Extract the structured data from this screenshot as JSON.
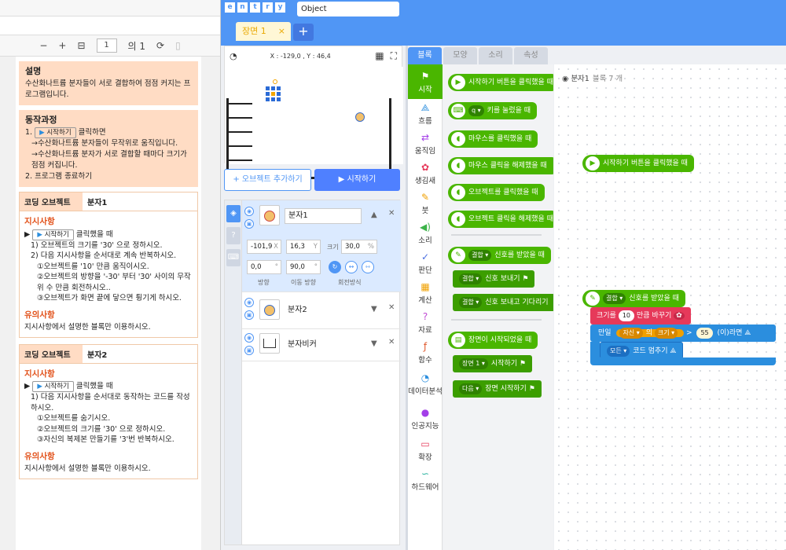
{
  "pdf": {
    "toolbar": {
      "minus": "−",
      "plus": "+",
      "page": "1",
      "of": "의 1"
    },
    "desc": {
      "title": "설명",
      "text": "수산화나트륨 분자들이 서로 결합하여 점점 커지는 프로그램입니다."
    },
    "process": {
      "title": "동작과정",
      "step1_pre": "1.",
      "start_btn": "시작하기",
      "step1_post": "클릭하면",
      "sub1": "→수산화나트륨 분자들이 무작위로 움직입니다.",
      "sub2": "→수산화나트륨 분자가 서로 결합할 때마다 크기가 점점 커집니다.",
      "step2": "2. 프로그램 종료하기"
    },
    "obj1": {
      "label": "코딩 오브젝트",
      "name": "분자1",
      "instr_title": "지시사항",
      "start_btn": "시작하기",
      "click_text": "클릭했을 때",
      "l1": "1) 오브젝트의 크기를 '30' 으로 정하시오.",
      "l2": "2) 다음 지시사항을 순서대로 계속 반복하시오.",
      "l3": "①오브젝트를 '10' 만큼 움직이시오.",
      "l4": "②오브젝트의 방향을 '-30' 부터 '30' 사이의 무작위 수 만큼 회전하시오..",
      "l5": "③오브젝트가 화면 끝에 닿으면 튕기게 하시오.",
      "note_title": "유의사항",
      "note": "지시사항에서 설명한 블록만 이용하시오."
    },
    "obj2": {
      "label": "코딩 오브젝트",
      "name": "분자2",
      "instr_title": "지시사항",
      "start_btn": "시작하기",
      "click_text": "클릭했을 때",
      "l1": "1) 다음 지시사항을 순서대로 동작하는 코드를 작성하시오.",
      "l2": "①오브젝트를 숨기시오.",
      "l3": "②오브젝트의 크기를 '30' 으로 정하시오.",
      "l4": "③자신의 복제본 만들기를 '3'번 반복하시오.",
      "note_title": "유의사항",
      "note": "지시사항에서 설명한 블록만 이용하시오."
    }
  },
  "app": {
    "logo": [
      "e",
      "n",
      "t",
      "r",
      "y"
    ],
    "object_field": "Object",
    "scene_tab": "장면 1",
    "scene_close": "×",
    "add_scene": "+",
    "coords": "X : -129,0 , Y : 46,4",
    "add_object": "+ 오브젝트 추가하기",
    "run": "▶ 시작하기",
    "objects": [
      {
        "name": "분자1"
      },
      {
        "name": "분자2"
      },
      {
        "name": "분자비커"
      }
    ],
    "props": {
      "x": "-101,9",
      "x_unit": "X",
      "y": "16,3",
      "y_unit": "Y",
      "size_label": "크기",
      "size": "30,0",
      "size_unit": "%",
      "dir": "0,0",
      "dir_unit": "°",
      "move_dir": "90,0",
      "move_dir_unit": "°",
      "dir_label": "방향",
      "move_dir_label": "이동 방향",
      "rot_label": "회전방식"
    },
    "block_tabs": [
      "블록",
      "모양",
      "소리",
      "속성"
    ],
    "categories": [
      "시작",
      "흐름",
      "움직임",
      "생김새",
      "붓",
      "소리",
      "판단",
      "계산",
      "자료",
      "함수",
      "데이터분석",
      "인공지능",
      "확장",
      "하드웨어"
    ],
    "palette": {
      "b1": "시작하기 버튼을 클릭했을 때",
      "b2_chip": "q ▾",
      "b2": "키를 눌렀을 때",
      "b3": "마우스를 클릭했을 때",
      "b4": "마우스 클릭을 해제했을 때",
      "b5": "오브젝트를 클릭했을 때",
      "b6": "오브젝트 클릭을 해제했을 때",
      "b7_chip": "결합 ▾",
      "b7": "신호를 받았을 때",
      "b8_chip": "결합 ▾",
      "b8": "신호 보내기",
      "b9_chip": "결합 ▾",
      "b9": "신호 보내고 기다리기",
      "b10": "장면이 시작되었을 때",
      "b11_chip": "장면 1 ▾",
      "b11": "시작하기",
      "b12_chip": "다음 ▾",
      "b12": "장면 시작하기"
    },
    "script": {
      "obj_label": "분자1",
      "count": "블록 7 개",
      "w1": "시작하기 버튼을 클릭했을 때",
      "w2_chip": "결합 ▾",
      "w2": "신호를 받았을 때",
      "w3_pre": "크기를",
      "w3_num": "10",
      "w3_post": "만큼 바꾸기",
      "w4_pre": "만일",
      "w4_self": "자신 ▾",
      "w4_of": "의",
      "w4_size": "크기 ▾",
      "w4_op": ">",
      "w4_num": "55",
      "w4_post": "(이)라면",
      "w5_chip": "모든 ▾",
      "w5": "코드 멈추기"
    }
  }
}
